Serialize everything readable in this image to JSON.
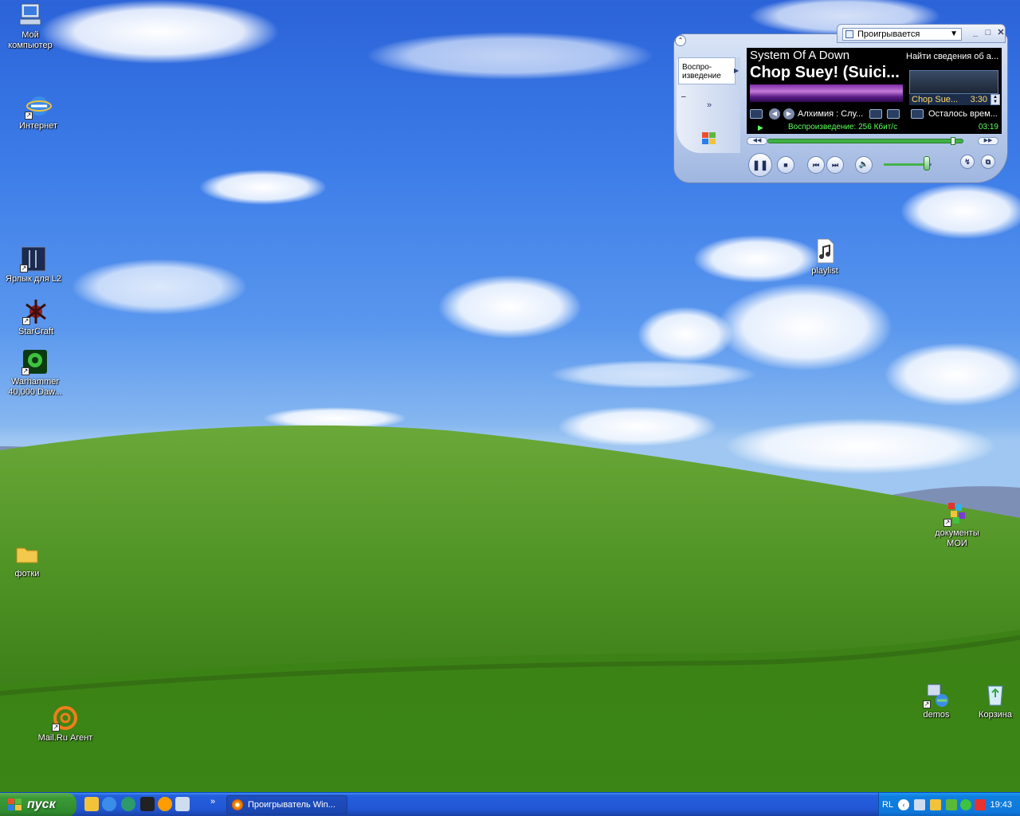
{
  "desktop": {
    "icons": [
      {
        "label": "Мой компьютер"
      },
      {
        "label": "Интернет"
      },
      {
        "label": "Ярлык для L2"
      },
      {
        "label": "StarCraft"
      },
      {
        "label": "Warhammer 40,000 Daw..."
      },
      {
        "label": "фотки"
      },
      {
        "label": "Mail.Ru Агент"
      },
      {
        "label": "playlist"
      },
      {
        "label": "документы МОИ"
      },
      {
        "label": "demos"
      },
      {
        "label": "Корзина"
      }
    ]
  },
  "player": {
    "view_dropdown": "Проигрывается",
    "task_button": "Воспро-\nизведение",
    "artist": "System Of A Down",
    "song": "Chop Suey! (Suici...",
    "find_info": "Найти сведения об а...",
    "track_short": "Chop Sue...",
    "track_length": "3:30",
    "album": "Алхимия : Слу...",
    "remaining": "Осталось врем...",
    "status": "Воспроизведение: 256 Кбит/с",
    "elapsed": "03:19",
    "seek_fraction": 0.948,
    "volume_fraction": 0.9
  },
  "taskbar": {
    "start_label": "пуск",
    "window_button": "Проигрыватель Win...",
    "language": "RL",
    "clock": "19:43"
  },
  "colors": {
    "taskbar_blue": "#245edc",
    "start_green": "#3c9a36",
    "tray_blue": "#0f7fe0",
    "status_green": "#5cff5c"
  }
}
